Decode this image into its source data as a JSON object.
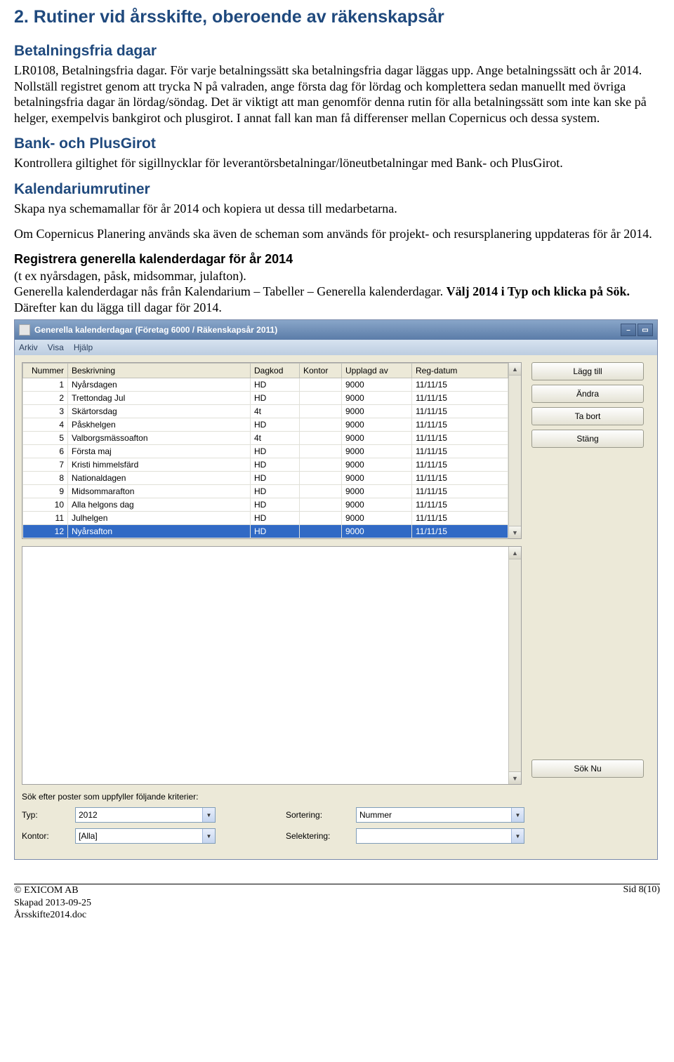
{
  "h2": "2. Rutiner vid årsskifte, oberoende av räkenskapsår",
  "sec1": {
    "title": "Betalningsfria dagar",
    "body": "LR0108, Betalningsfria dagar. För varje betalningssätt ska betalningsfria dagar läggas upp. Ange betalningssätt och år 2014. Nollställ registret genom att trycka N på valraden, ange första dag för lördag och komplettera sedan manuellt med övriga betalningsfria dagar än lördag/söndag. Det är viktigt att man genomför denna rutin för alla betalningssätt som inte kan ske på helger, exempelvis bankgirot och plusgirot. I annat fall kan man få differenser mellan Copernicus och dessa system."
  },
  "sec2": {
    "title": "Bank- och PlusGirot",
    "body": "Kontrollera giltighet för sigillnycklar för leverantörsbetalningar/löneutbetalningar med Bank- och PlusGirot."
  },
  "sec3": {
    "title": "Kalendariumrutiner",
    "body1": "Skapa nya schemamallar för år 2014 och kopiera ut dessa till medarbetarna.",
    "body2": "Om Copernicus Planering används ska även de scheman som används för projekt- och resursplanering uppdateras för år 2014."
  },
  "sec4": {
    "title": "Registrera generella kalenderdagar för år 2014",
    "body1": "(t ex nyårsdagen, påsk, midsommar, julafton).",
    "body2a": "Generella kalenderdagar nås från Kalendarium – Tabeller – Generella kalenderdagar. ",
    "body2b": "Välj 2014 i Typ och klicka på Sök.",
    "body2c": " Därefter kan du lägga till dagar för 2014."
  },
  "window": {
    "title": "Generella kalenderdagar (Företag 6000 / Räkenskapsår 2011)",
    "menu": {
      "arkiv": "Arkiv",
      "visa": "Visa",
      "hjalp": "Hjälp"
    },
    "columns": {
      "nummer": "Nummer",
      "beskrivning": "Beskrivning",
      "dagkod": "Dagkod",
      "kontor": "Kontor",
      "upplagd": "Upplagd av",
      "regdatum": "Reg-datum"
    },
    "rows": [
      {
        "n": "1",
        "b": "Nyårsdagen",
        "d": "HD",
        "k": "",
        "u": "9000",
        "r": "11/11/15"
      },
      {
        "n": "2",
        "b": "Trettondag Jul",
        "d": "HD",
        "k": "",
        "u": "9000",
        "r": "11/11/15"
      },
      {
        "n": "3",
        "b": "Skärtorsdag",
        "d": "4t",
        "k": "",
        "u": "9000",
        "r": "11/11/15"
      },
      {
        "n": "4",
        "b": "Påskhelgen",
        "d": "HD",
        "k": "",
        "u": "9000",
        "r": "11/11/15"
      },
      {
        "n": "5",
        "b": "Valborgsmässoafton",
        "d": "4t",
        "k": "",
        "u": "9000",
        "r": "11/11/15"
      },
      {
        "n": "6",
        "b": "Första maj",
        "d": "HD",
        "k": "",
        "u": "9000",
        "r": "11/11/15"
      },
      {
        "n": "7",
        "b": "Kristi himmelsfärd",
        "d": "HD",
        "k": "",
        "u": "9000",
        "r": "11/11/15"
      },
      {
        "n": "8",
        "b": "Nationaldagen",
        "d": "HD",
        "k": "",
        "u": "9000",
        "r": "11/11/15"
      },
      {
        "n": "9",
        "b": "Midsommarafton",
        "d": "HD",
        "k": "",
        "u": "9000",
        "r": "11/11/15"
      },
      {
        "n": "10",
        "b": "Alla helgons dag",
        "d": "HD",
        "k": "",
        "u": "9000",
        "r": "11/11/15"
      },
      {
        "n": "11",
        "b": "Julhelgen",
        "d": "HD",
        "k": "",
        "u": "9000",
        "r": "11/11/15"
      },
      {
        "n": "12",
        "b": "Nyårsafton",
        "d": "HD",
        "k": "",
        "u": "9000",
        "r": "11/11/15"
      }
    ],
    "buttons": {
      "add": "Lägg till",
      "edit": "Ändra",
      "delete": "Ta bort",
      "close": "Stäng",
      "search": "Sök Nu"
    },
    "search": {
      "label": "Sök efter poster som uppfyller följande kriterier:",
      "typ_label": "Typ:",
      "typ_value": "2012",
      "sortering_label": "Sortering:",
      "sortering_value": "Nummer",
      "kontor_label": "Kontor:",
      "kontor_value": "[Alla]",
      "selektering_label": "Selektering:",
      "selektering_value": ""
    }
  },
  "footer": {
    "copyright": "© EXICOM AB",
    "created": "Skapad 2013-09-25",
    "filename": "Årsskifte2014.doc",
    "page": "Sid 8(10)"
  }
}
